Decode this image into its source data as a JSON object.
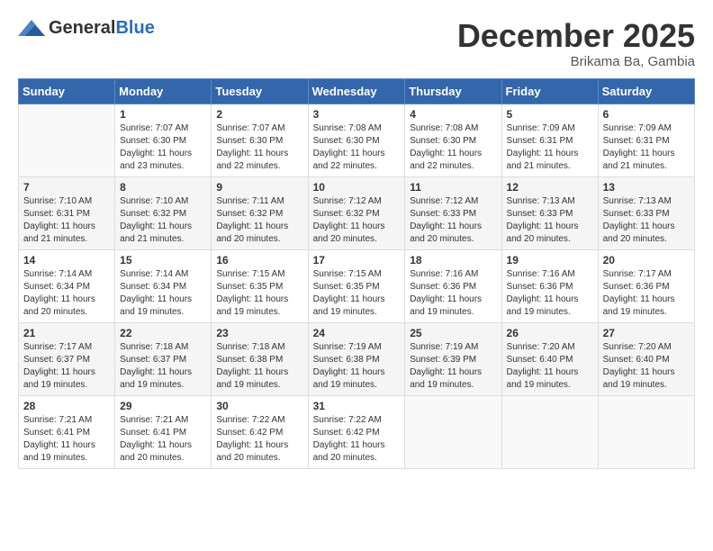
{
  "header": {
    "logo_line1": "General",
    "logo_line2": "Blue",
    "month": "December 2025",
    "location": "Brikama Ba, Gambia"
  },
  "weekdays": [
    "Sunday",
    "Monday",
    "Tuesday",
    "Wednesday",
    "Thursday",
    "Friday",
    "Saturday"
  ],
  "weeks": [
    [
      {
        "day": "",
        "content": ""
      },
      {
        "day": "1",
        "content": "Sunrise: 7:07 AM\nSunset: 6:30 PM\nDaylight: 11 hours\nand 23 minutes."
      },
      {
        "day": "2",
        "content": "Sunrise: 7:07 AM\nSunset: 6:30 PM\nDaylight: 11 hours\nand 22 minutes."
      },
      {
        "day": "3",
        "content": "Sunrise: 7:08 AM\nSunset: 6:30 PM\nDaylight: 11 hours\nand 22 minutes."
      },
      {
        "day": "4",
        "content": "Sunrise: 7:08 AM\nSunset: 6:30 PM\nDaylight: 11 hours\nand 22 minutes."
      },
      {
        "day": "5",
        "content": "Sunrise: 7:09 AM\nSunset: 6:31 PM\nDaylight: 11 hours\nand 21 minutes."
      },
      {
        "day": "6",
        "content": "Sunrise: 7:09 AM\nSunset: 6:31 PM\nDaylight: 11 hours\nand 21 minutes."
      }
    ],
    [
      {
        "day": "7",
        "content": "Sunrise: 7:10 AM\nSunset: 6:31 PM\nDaylight: 11 hours\nand 21 minutes."
      },
      {
        "day": "8",
        "content": "Sunrise: 7:10 AM\nSunset: 6:32 PM\nDaylight: 11 hours\nand 21 minutes."
      },
      {
        "day": "9",
        "content": "Sunrise: 7:11 AM\nSunset: 6:32 PM\nDaylight: 11 hours\nand 20 minutes."
      },
      {
        "day": "10",
        "content": "Sunrise: 7:12 AM\nSunset: 6:32 PM\nDaylight: 11 hours\nand 20 minutes."
      },
      {
        "day": "11",
        "content": "Sunrise: 7:12 AM\nSunset: 6:33 PM\nDaylight: 11 hours\nand 20 minutes."
      },
      {
        "day": "12",
        "content": "Sunrise: 7:13 AM\nSunset: 6:33 PM\nDaylight: 11 hours\nand 20 minutes."
      },
      {
        "day": "13",
        "content": "Sunrise: 7:13 AM\nSunset: 6:33 PM\nDaylight: 11 hours\nand 20 minutes."
      }
    ],
    [
      {
        "day": "14",
        "content": "Sunrise: 7:14 AM\nSunset: 6:34 PM\nDaylight: 11 hours\nand 20 minutes."
      },
      {
        "day": "15",
        "content": "Sunrise: 7:14 AM\nSunset: 6:34 PM\nDaylight: 11 hours\nand 19 minutes."
      },
      {
        "day": "16",
        "content": "Sunrise: 7:15 AM\nSunset: 6:35 PM\nDaylight: 11 hours\nand 19 minutes."
      },
      {
        "day": "17",
        "content": "Sunrise: 7:15 AM\nSunset: 6:35 PM\nDaylight: 11 hours\nand 19 minutes."
      },
      {
        "day": "18",
        "content": "Sunrise: 7:16 AM\nSunset: 6:36 PM\nDaylight: 11 hours\nand 19 minutes."
      },
      {
        "day": "19",
        "content": "Sunrise: 7:16 AM\nSunset: 6:36 PM\nDaylight: 11 hours\nand 19 minutes."
      },
      {
        "day": "20",
        "content": "Sunrise: 7:17 AM\nSunset: 6:36 PM\nDaylight: 11 hours\nand 19 minutes."
      }
    ],
    [
      {
        "day": "21",
        "content": "Sunrise: 7:17 AM\nSunset: 6:37 PM\nDaylight: 11 hours\nand 19 minutes."
      },
      {
        "day": "22",
        "content": "Sunrise: 7:18 AM\nSunset: 6:37 PM\nDaylight: 11 hours\nand 19 minutes."
      },
      {
        "day": "23",
        "content": "Sunrise: 7:18 AM\nSunset: 6:38 PM\nDaylight: 11 hours\nand 19 minutes."
      },
      {
        "day": "24",
        "content": "Sunrise: 7:19 AM\nSunset: 6:38 PM\nDaylight: 11 hours\nand 19 minutes."
      },
      {
        "day": "25",
        "content": "Sunrise: 7:19 AM\nSunset: 6:39 PM\nDaylight: 11 hours\nand 19 minutes."
      },
      {
        "day": "26",
        "content": "Sunrise: 7:20 AM\nSunset: 6:40 PM\nDaylight: 11 hours\nand 19 minutes."
      },
      {
        "day": "27",
        "content": "Sunrise: 7:20 AM\nSunset: 6:40 PM\nDaylight: 11 hours\nand 19 minutes."
      }
    ],
    [
      {
        "day": "28",
        "content": "Sunrise: 7:21 AM\nSunset: 6:41 PM\nDaylight: 11 hours\nand 19 minutes."
      },
      {
        "day": "29",
        "content": "Sunrise: 7:21 AM\nSunset: 6:41 PM\nDaylight: 11 hours\nand 20 minutes."
      },
      {
        "day": "30",
        "content": "Sunrise: 7:22 AM\nSunset: 6:42 PM\nDaylight: 11 hours\nand 20 minutes."
      },
      {
        "day": "31",
        "content": "Sunrise: 7:22 AM\nSunset: 6:42 PM\nDaylight: 11 hours\nand 20 minutes."
      },
      {
        "day": "",
        "content": ""
      },
      {
        "day": "",
        "content": ""
      },
      {
        "day": "",
        "content": ""
      }
    ]
  ],
  "shaded_rows": [
    1,
    3
  ]
}
